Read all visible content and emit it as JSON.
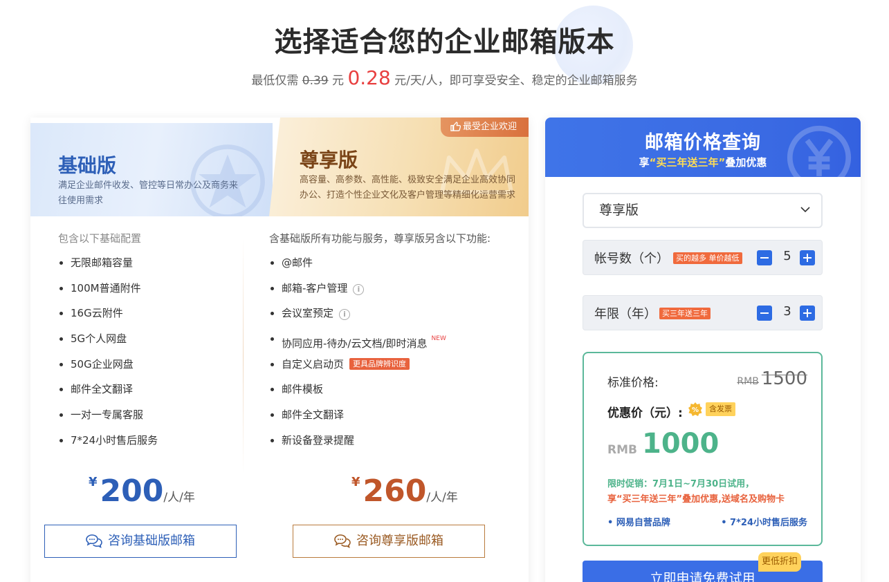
{
  "header": {
    "title": "选择适合您的企业邮箱版本",
    "subtitle_prefix": "最低仅需 ",
    "old_price": "0.39",
    "yuan1": " 元 ",
    "new_price": "0.28",
    "subtitle_suffix": " 元/天/人，即可享受安全、稳定的企业邮箱服务"
  },
  "basic": {
    "name": "基础版",
    "desc": "满足企业邮件收发、管控等日常办公及商务来往使用需求",
    "features_title": "包含以下基础配置",
    "features": [
      "无限邮箱容量",
      "100M普通附件",
      "16G云附件",
      "5G个人网盘",
      "50G企业网盘",
      "邮件全文翻译",
      "一对一专属客服",
      "7*24小时售后服务"
    ],
    "currency": "¥",
    "price": "200",
    "unit": "/人/年",
    "consult": "咨询基础版邮箱"
  },
  "premium": {
    "badge": "最受企业欢迎",
    "name": "尊享版",
    "desc": "高容量、高参数、高性能、极致安全满足企业高效协同 办公、打造个性企业文化及客户管理等精细化运营需求",
    "features_title": "含基础版所有功能与服务，尊享版另含以下功能:",
    "features": [
      "@邮件",
      "邮箱-客户管理",
      "会议室预定",
      "协同应用-待办/云文档/即时消息",
      "自定义启动页",
      "邮件模板",
      "邮件全文翻译",
      "新设备登录提醒"
    ],
    "new_tag": "NEW",
    "brand_tag": "更具品牌辨识度",
    "currency": "¥",
    "price": "260",
    "unit": "/人/年",
    "consult": "咨询尊享版邮箱"
  },
  "calculator": {
    "title": "邮箱价格查询",
    "sub_prefix": "享",
    "sub_highlight": "“买三年送三年”",
    "sub_suffix": "叠加优惠",
    "edition_selected": "尊享版",
    "accounts_label": "帐号数（个）",
    "accounts_tag": "买的越多 单价越低",
    "accounts_value": "5",
    "years_label": "年限（年）",
    "years_tag": "买三年送三年",
    "years_value": "3",
    "std_label": "标准价格:",
    "std_currency": "RMB",
    "std_value": "1500",
    "discount_label": "优惠价（元）:",
    "invoice_tag": "含发票",
    "rmb_label": "RMB",
    "rmb_value": "1000",
    "promo_line1": "限时促销：7月1日~7月30日试用，",
    "promo_line2": "享“买三年送三年”叠加优惠,送域名及购物卡",
    "bullet1": "• 网易自营品牌",
    "bullet2": "• 7*24小时售后服务",
    "apply_button": "立即申请免费试用",
    "lowest_tag": "更低折扣"
  },
  "colors": {
    "basic_accent": "#2d5fb7",
    "premium_accent": "#c0562a",
    "calc_header": "#3a6ae3",
    "discount_green": "#4db38a",
    "promo_orange": "#e8623d"
  }
}
